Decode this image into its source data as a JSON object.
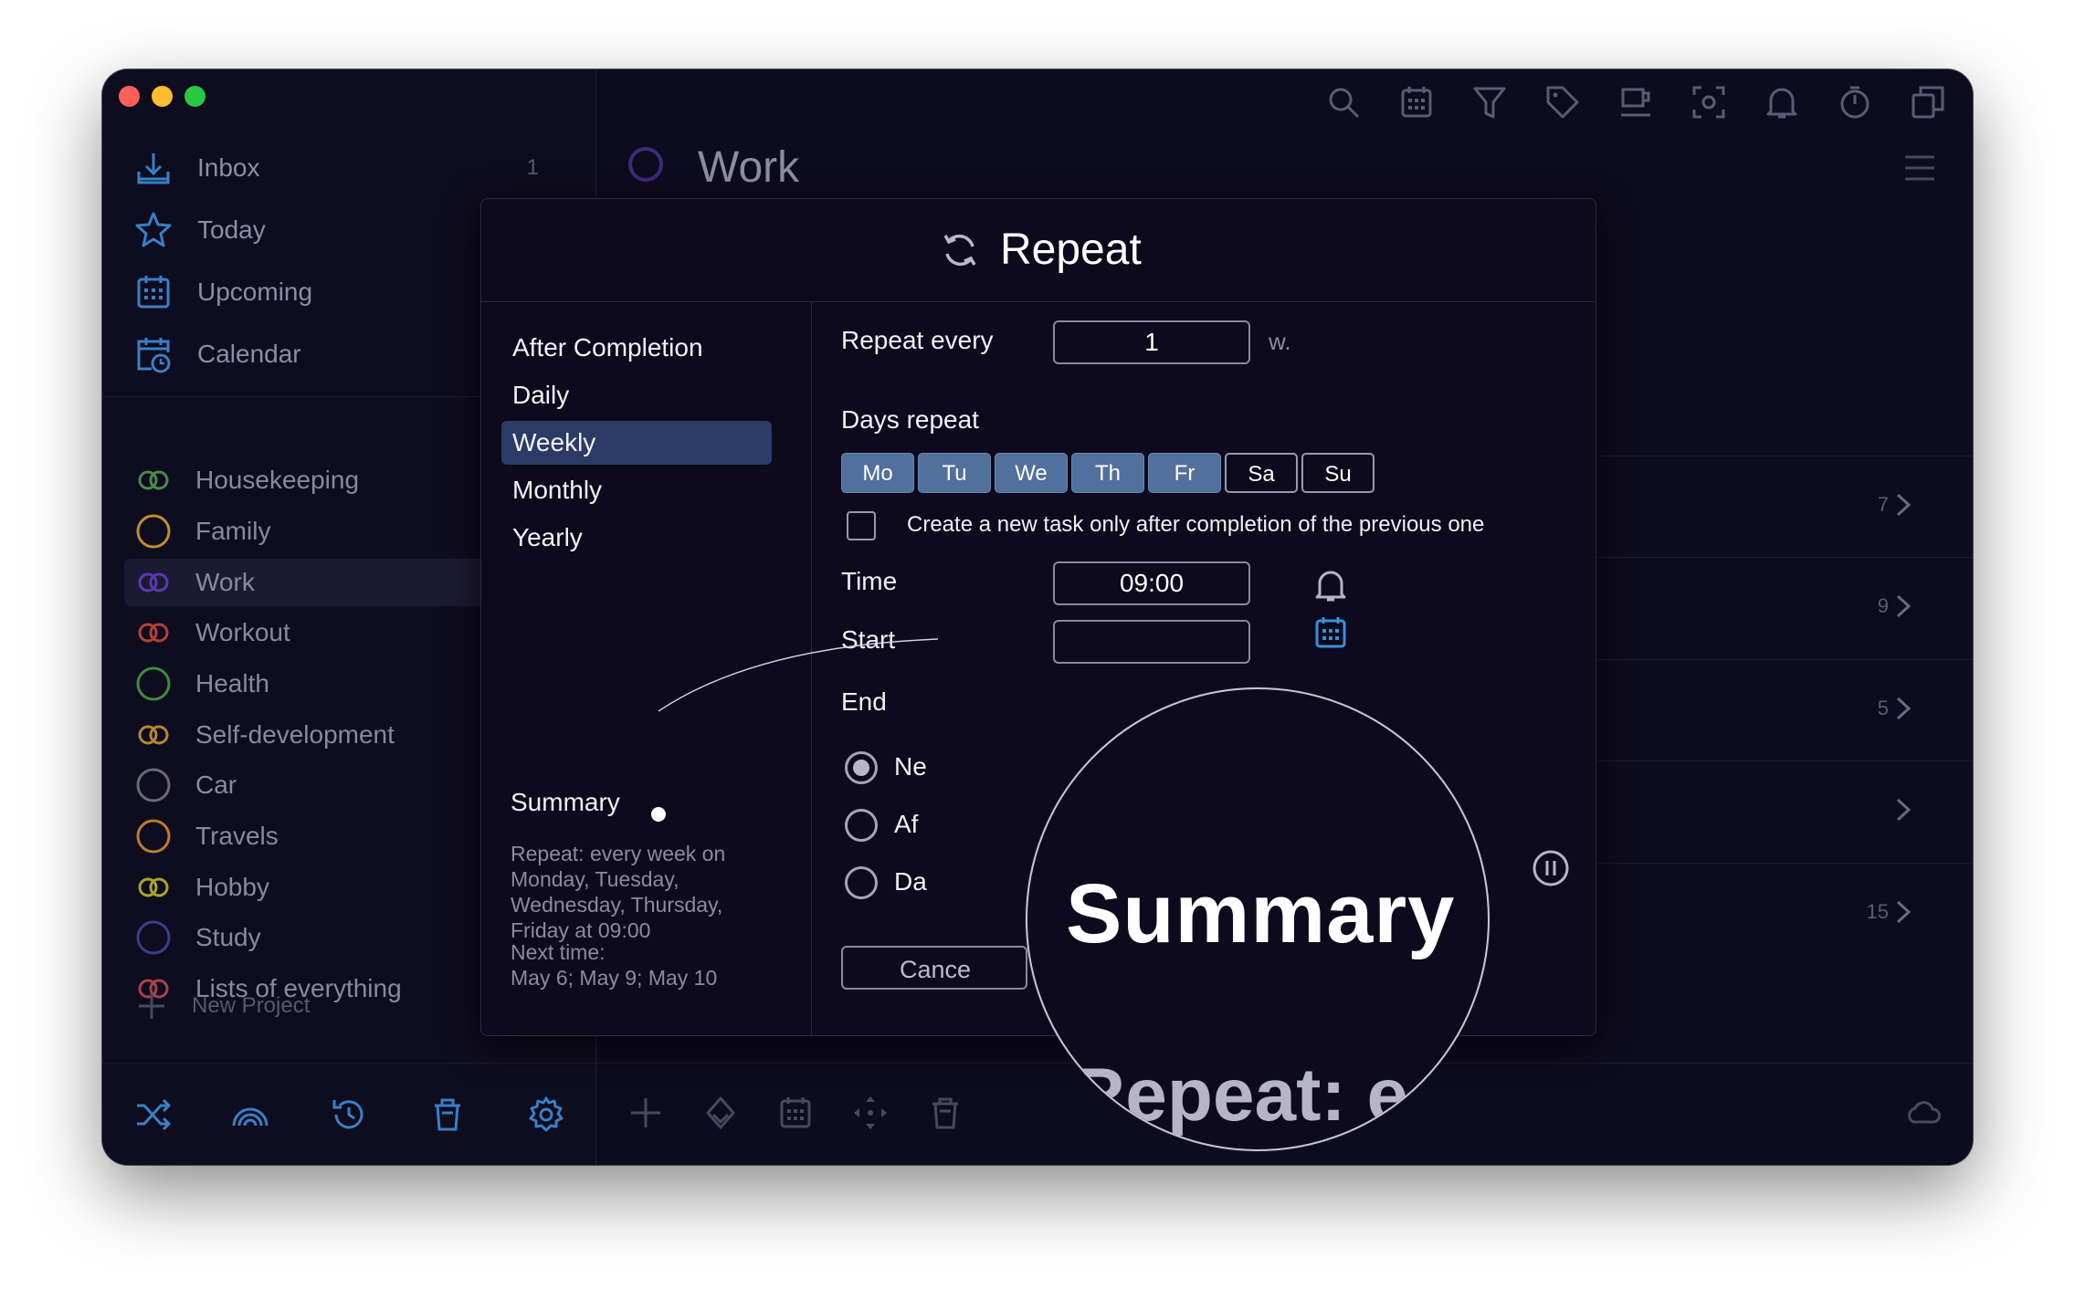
{
  "sidebar": {
    "nav": [
      {
        "label": "Inbox",
        "icon": "inbox-icon",
        "count": "1"
      },
      {
        "label": "Today",
        "icon": "star-icon",
        "count": ""
      },
      {
        "label": "Upcoming",
        "icon": "calendar-grid-icon",
        "count": ""
      },
      {
        "label": "Calendar",
        "icon": "calendar-clock-icon",
        "count": ""
      }
    ],
    "projects": [
      {
        "label": "Housekeeping",
        "color": "#4a8a4a",
        "style": "double"
      },
      {
        "label": "Family",
        "color": "#c0902e",
        "style": "single"
      },
      {
        "label": "Work",
        "color": "#5a3aa8",
        "style": "double"
      },
      {
        "label": "Workout",
        "color": "#b3413a",
        "style": "double"
      },
      {
        "label": "Health",
        "color": "#3e8a3e",
        "style": "single"
      },
      {
        "label": "Self-development",
        "color": "#b58630",
        "style": "double"
      },
      {
        "label": "Car",
        "color": "#6a6878",
        "style": "single"
      },
      {
        "label": "Travels",
        "color": "#c07a2a",
        "style": "single"
      },
      {
        "label": "Hobby",
        "color": "#a8a42e",
        "style": "double"
      },
      {
        "label": "Study",
        "color": "#3a3e8a",
        "style": "single"
      },
      {
        "label": "Lists of everything",
        "color": "#a8414a",
        "style": "double"
      }
    ],
    "new_project_label": "New Project",
    "bottom_icons": [
      "shuffle-icon",
      "rainbow-icon",
      "history-icon",
      "trash-icon",
      "settings-icon"
    ]
  },
  "main": {
    "title": "Work",
    "top_icons": [
      "search-icon",
      "calendar-icon",
      "filter-icon",
      "tag-icon",
      "coffee-icon",
      "focus-icon",
      "bell-icon",
      "timer-icon",
      "copy-icon"
    ],
    "row_counts": [
      "7",
      "9",
      "5",
      "",
      "15"
    ],
    "bottom_icons": [
      "plus-icon",
      "priority-icon",
      "calendar-icon",
      "move-icon",
      "trash-icon"
    ]
  },
  "dialog": {
    "title": "Repeat",
    "options": [
      "After Completion",
      "Daily",
      "Weekly",
      "Monthly",
      "Yearly"
    ],
    "selected_option": "Weekly",
    "summary_label": "Summary",
    "summary_text": "Repeat: every week on Monday, Tuesday, Wednesday, Thursday, Friday at 09:00",
    "next_label": "Next time:",
    "next_dates": "May 6; May 9; May 10",
    "repeat_every_label": "Repeat every",
    "repeat_every_value": "1",
    "repeat_unit": "w.",
    "days_repeat_label": "Days repeat",
    "days": [
      {
        "label": "Mo",
        "on": true
      },
      {
        "label": "Tu",
        "on": true
      },
      {
        "label": "We",
        "on": true
      },
      {
        "label": "Th",
        "on": true
      },
      {
        "label": "Fr",
        "on": true
      },
      {
        "label": "Sa",
        "on": false
      },
      {
        "label": "Su",
        "on": false
      }
    ],
    "checkbox_label": "Create a new task only after completion of the previous one",
    "time_label": "Time",
    "time_value": "09:00",
    "start_label": "Start",
    "end_label": "End",
    "end_options": [
      "Ne",
      "Af",
      "Da"
    ],
    "cancel_label": "Cance",
    "magnifier": {
      "title": "Summary",
      "sub": "Repeat: e"
    }
  },
  "colors": {
    "accent": "#2b3a66",
    "day_on": "#52709c",
    "window_bg": "#0d0b1e"
  }
}
